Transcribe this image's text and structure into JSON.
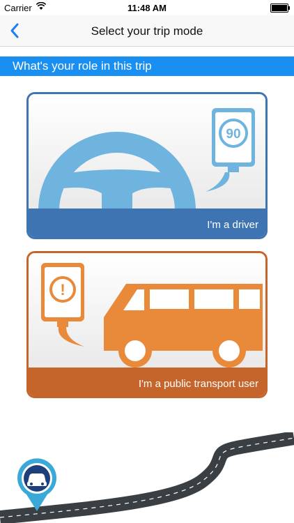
{
  "status_bar": {
    "carrier": "Carrier",
    "time": "11:48 AM",
    "wifi_icon": "wifi-icon",
    "battery_icon": "battery-icon"
  },
  "nav": {
    "title": "Select your trip mode",
    "back_icon": "chevron-left-icon"
  },
  "section": {
    "header": "What's your role in this trip"
  },
  "options": {
    "driver": {
      "label": "I'm a driver",
      "speed_value": "90",
      "color": "#3f74b3",
      "art_color": "#6fb4de"
    },
    "transport": {
      "label": "I'm a public transport user",
      "alert_symbol": "!",
      "color": "#c5652b",
      "art_color": "#e88a3a"
    }
  },
  "footer": {
    "pin_icon": "car-location-pin-icon",
    "road_icon": "winding-road-icon",
    "pin_color": "#3aa9d8"
  }
}
